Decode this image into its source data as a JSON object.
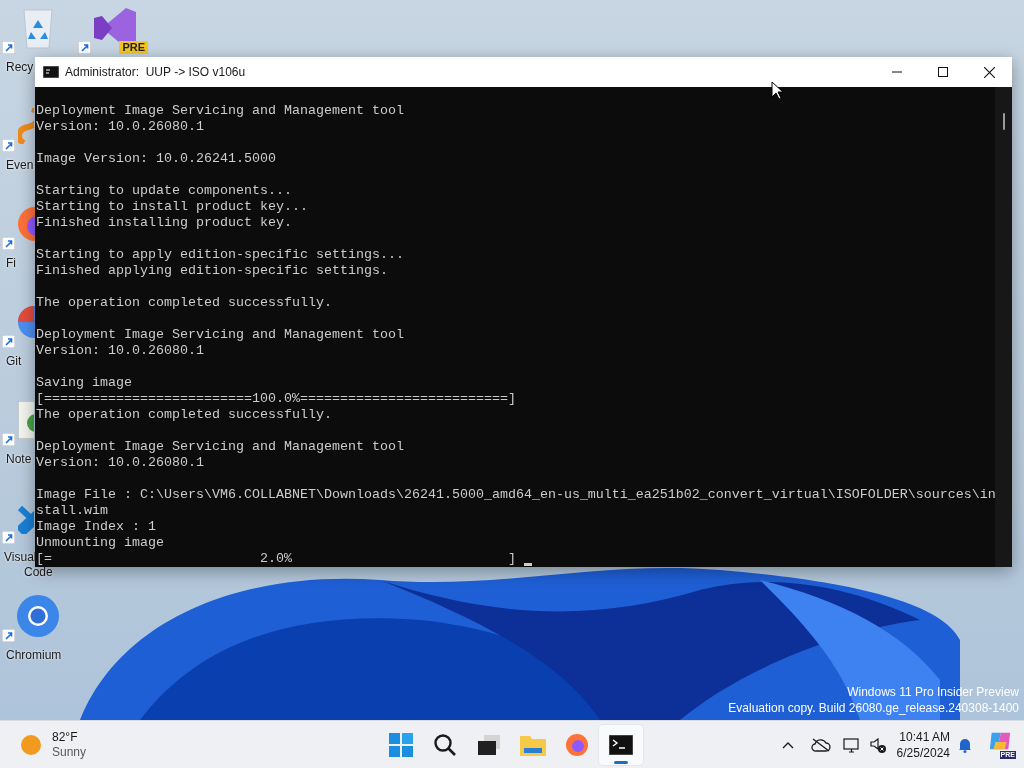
{
  "desktop": {
    "columns": [
      [
        {
          "kind": "recycle-bin",
          "label": [
            "Recy"
          ]
        },
        {
          "kind": "everything",
          "label": [
            "Even"
          ]
        },
        {
          "kind": "firefox",
          "label": [
            "Fi"
          ]
        },
        {
          "kind": "git",
          "label": [
            "Git"
          ]
        },
        {
          "kind": "notepad",
          "label": [
            "Note"
          ]
        },
        {
          "kind": "vscode",
          "label": [
            "Visual",
            "Code"
          ]
        },
        {
          "kind": "chromium",
          "label": [
            "Chromium"
          ]
        }
      ],
      [
        {
          "kind": "visual-studio",
          "badge": "PRE"
        }
      ]
    ],
    "watermark": [
      "Windows 11 Pro Insider Preview",
      "Evaluation copy. Build 26080.ge_release.240308-1400"
    ]
  },
  "window": {
    "title": "Administrator:  UUP -> ISO v106u",
    "console": {
      "blocks": [
        [
          "Deployment Image Servicing and Management tool",
          "Version: 10.0.26080.1"
        ],
        [
          "Image Version: 10.0.26241.5000"
        ],
        [
          "Starting to update components...",
          "Starting to install product key...",
          "Finished installing product key."
        ],
        [
          "Starting to apply edition-specific settings...",
          "Finished applying edition-specific settings."
        ],
        [
          "The operation completed successfully."
        ],
        [
          "Deployment Image Servicing and Management tool",
          "Version: 10.0.26080.1"
        ],
        [
          "Saving image",
          "[==========================100.0%==========================]",
          "The operation completed successfully."
        ],
        [
          "Deployment Image Servicing and Management tool",
          "Version: 10.0.26080.1"
        ],
        [
          "Image File : C:\\Users\\VM6.COLLABNET\\Downloads\\26241.5000_amd64_en-us_multi_ea251b02_convert_virtual\\ISOFOLDER\\sources\\in",
          "stall.wim",
          "Image Index : 1",
          "Unmounting image",
          "[=                          2.0%                           ]"
        ]
      ]
    }
  },
  "taskbar": {
    "weather": {
      "temperature": "82°F",
      "condition": "Sunny"
    },
    "apps": [
      {
        "kind": "start",
        "selected": false
      },
      {
        "kind": "search",
        "selected": false
      },
      {
        "kind": "task-view",
        "selected": false
      },
      {
        "kind": "file-explorer",
        "selected": false
      },
      {
        "kind": "firefox",
        "selected": false
      },
      {
        "kind": "terminal",
        "selected": true
      }
    ],
    "clock": {
      "time": "10:41 AM",
      "date": "6/25/2024"
    },
    "copilot_badge": "PRE"
  }
}
